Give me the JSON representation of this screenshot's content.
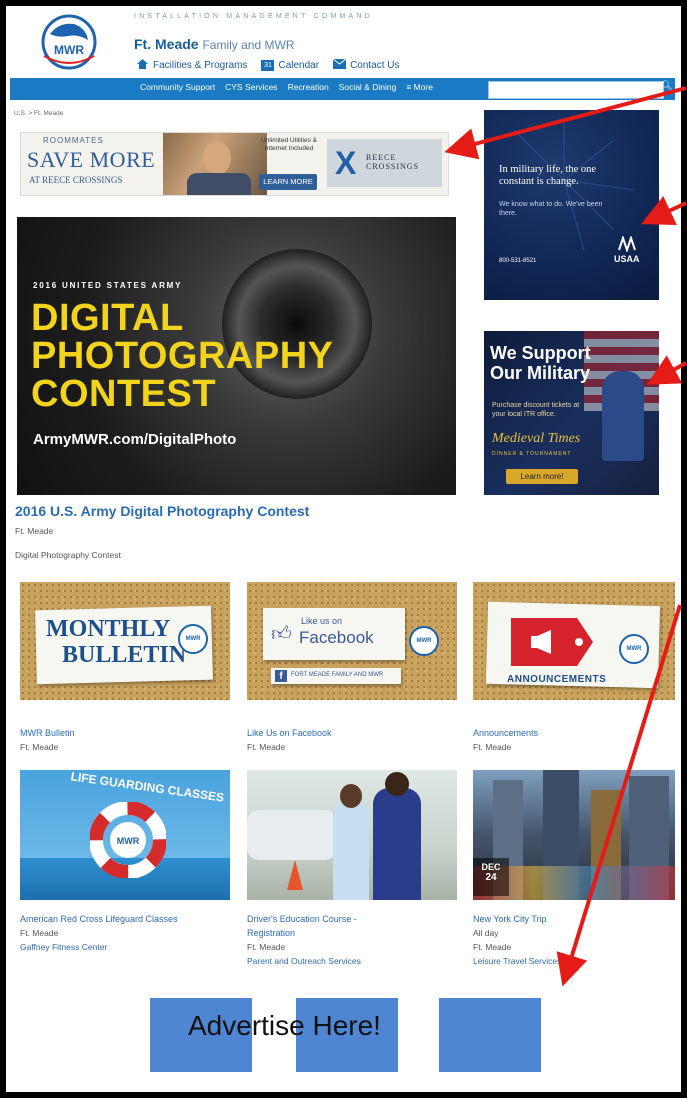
{
  "header": {
    "org_name": "INSTALLATION MANAGEMENT COMMAND",
    "site_title_bold": "Ft. Meade",
    "site_title_rest": "Family and MWR",
    "logo_text": "MWR",
    "links": [
      {
        "icon": "house-icon",
        "label": "Facilities & Programs"
      },
      {
        "icon": "calendar-icon",
        "label": "Calendar",
        "icon_text": "31"
      },
      {
        "icon": "mail-icon",
        "label": "Contact Us"
      }
    ]
  },
  "navbar": {
    "items": [
      "Community Support",
      "CYS Services",
      "Recreation",
      "Social & Dining",
      "≡ More"
    ],
    "search_placeholder": "",
    "search_icon": "search-icon"
  },
  "breadcrumb": "U.S. > Ft. Meade",
  "reece_ad": {
    "line1": "ROOMMATES",
    "line2": "SAVE MORE",
    "line3": "AT REECE CROSSINGS",
    "wifi": "Unlimited Utilities & Internet Included",
    "cta": "LEARN MORE",
    "brand": "REECE CROSSINGS"
  },
  "hero": {
    "subheading": "2016 UNITED STATES ARMY",
    "line1": "DIGITAL",
    "line2": "PHOTOGRAPHY",
    "line3": "CONTEST",
    "url": "ArmyMWR.com/DigitalPhoto"
  },
  "article": {
    "title": "2016 U.S. Army Digital Photography Contest",
    "location": "Ft. Meade",
    "description": "Digital Photography Contest"
  },
  "usaa_ad": {
    "headline": "In military life, the one constant is change.",
    "sub": "We know what to do. We've been there.",
    "phone": "800-531-8521",
    "brand": "USAA"
  },
  "medieval_ad": {
    "headline_1": "We Support",
    "headline_2": "Our Military",
    "body": "Purchase discount tickets at your local ITR office.",
    "brand": "Medieval Times",
    "brand_sub": "DINNER & TOURNAMENT",
    "cta": "Learn more!"
  },
  "tiles": [
    {
      "image_text": [
        "MONTHLY",
        "BULLETIN"
      ],
      "caption": "MWR Bulletin",
      "location": "Ft. Meade"
    },
    {
      "image_text": [
        "Like us on",
        "Facebook"
      ],
      "image_footer": "FORT MEADE FAMILY AND MWR",
      "caption": "Like Us on Facebook",
      "location": "Ft. Meade"
    },
    {
      "image_text": [
        "ANNOUNCEMENTS"
      ],
      "caption": "Announcements",
      "location": "Ft. Meade"
    },
    {
      "image_text": [
        "LIFE GUARDING CLASSES"
      ],
      "caption": "American Red Cross Lifeguard Classes",
      "location": "Ft. Meade",
      "link": "Gaffney Fitness Center"
    },
    {
      "caption": "Driver's Education Course -",
      "caption_2": "Registration",
      "location": "Ft. Meade",
      "link": "Parent and Outreach Services"
    },
    {
      "date_month": "DEC",
      "date_day": "24",
      "caption": "New York City Trip",
      "time": "All day",
      "location": "Ft. Meade",
      "link": "Leisure Travel Services"
    }
  ],
  "advert_text": "Advertise Here!",
  "colors": {
    "brand_blue": "#1a7ac4",
    "link_blue": "#2a6cb3",
    "hero_yellow": "#f2d41c",
    "arrow_red": "#e41b17",
    "placeholder_blue": "#4f86d3"
  }
}
